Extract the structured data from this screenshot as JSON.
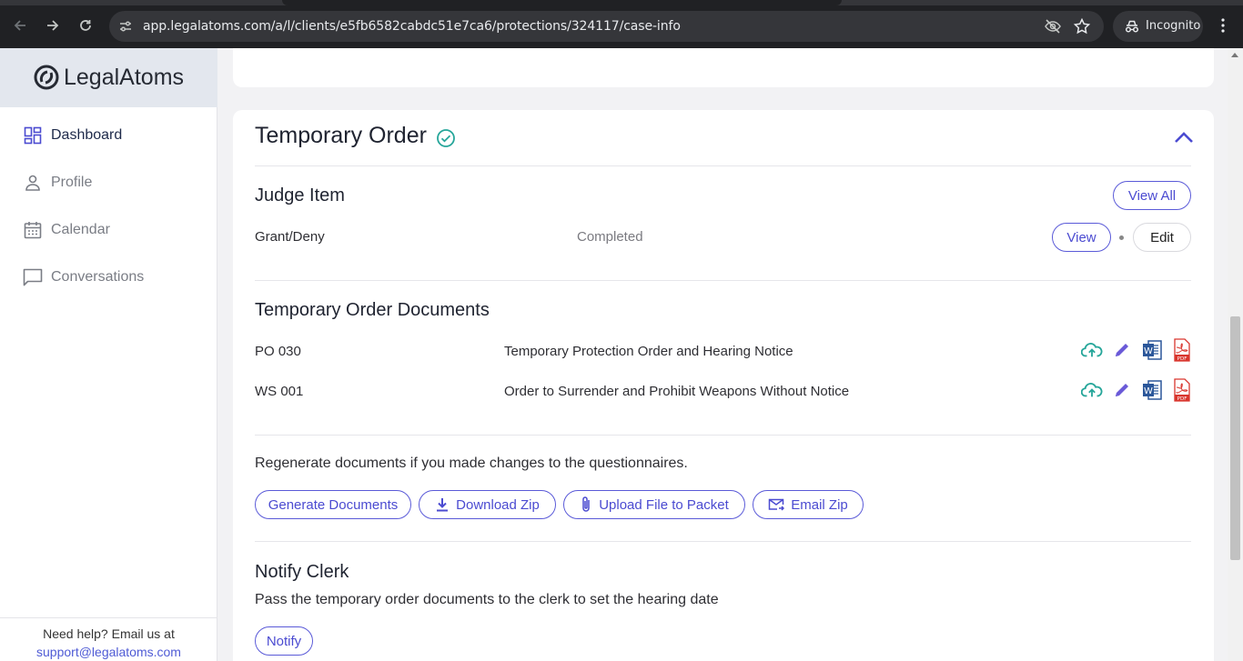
{
  "browser": {
    "url": "app.legalatoms.com/a/l/clients/e5fb6582cabdc51e7ca6/protections/324117/case-info",
    "incognito_label": "Incognito"
  },
  "sidebar": {
    "logo": "LegalAtoms",
    "items": [
      {
        "label": "Dashboard",
        "icon": "dashboard-icon"
      },
      {
        "label": "Profile",
        "icon": "person-icon"
      },
      {
        "label": "Calendar",
        "icon": "calendar-icon"
      },
      {
        "label": "Conversations",
        "icon": "chat-icon"
      }
    ],
    "help_text": "Need help? Email us at",
    "help_email": "support@legalatoms.com"
  },
  "section": {
    "title": "Temporary Order",
    "judge": {
      "heading": "Judge Item",
      "view_all": "View All",
      "item_name": "Grant/Deny",
      "item_status": "Completed",
      "view": "View",
      "edit": "Edit"
    },
    "documents": {
      "heading": "Temporary Order Documents",
      "rows": [
        {
          "code": "PO 030",
          "title": "Temporary Protection Order and Hearing Notice"
        },
        {
          "code": "WS 001",
          "title": "Order to Surrender and Prohibit Weapons Without Notice"
        }
      ],
      "regen_note": "Regenerate documents if you made changes to the questionnaires.",
      "generate": "Generate Documents",
      "download_zip": "Download Zip",
      "upload": "Upload File to Packet",
      "email_zip": "Email Zip"
    },
    "clerk": {
      "heading": "Notify Clerk",
      "description": "Pass the temporary order documents to the clerk to set the hearing date",
      "notify": "Notify"
    }
  },
  "colors": {
    "accent": "#4b4bd1",
    "teal": "#26a69a",
    "word": "#2b579a",
    "pdf": "#d9362e"
  }
}
